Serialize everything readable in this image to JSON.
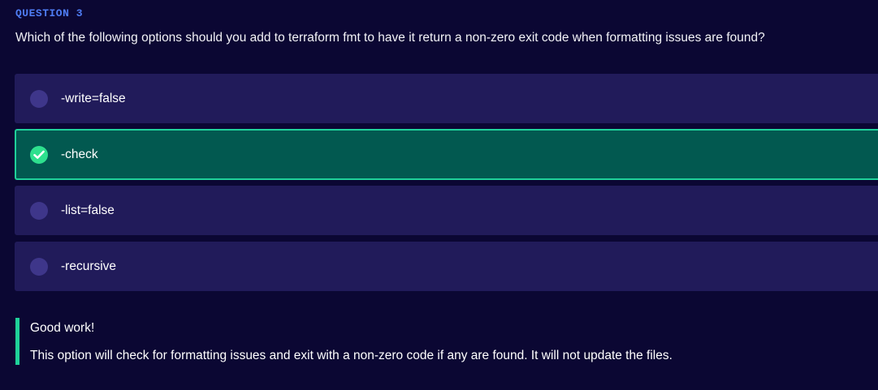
{
  "question": {
    "label": "QUESTION 3",
    "text": "Which of the following options should you add to terraform fmt to have it return a non-zero exit code when formatting issues are found?"
  },
  "options": [
    {
      "label": "-write=false",
      "selected": false
    },
    {
      "label": "-check",
      "selected": true
    },
    {
      "label": "-list=false",
      "selected": false
    },
    {
      "label": "-recursive",
      "selected": false
    }
  ],
  "feedback": {
    "title": "Good work!",
    "body": "This option will check for formatting issues and exit with a non-zero code if any are found. It will not update the files."
  },
  "colors": {
    "background": "#0b0733",
    "question_label": "#4f7df5",
    "option_bg": "#211b5a",
    "selected_bg": "#025950",
    "success_accent": "#1fd19a",
    "radio": "#3e368a",
    "check_circle": "#2ee08e"
  },
  "icons": {
    "selected": "check-circle-icon",
    "unselected": "radio-circle-icon"
  }
}
